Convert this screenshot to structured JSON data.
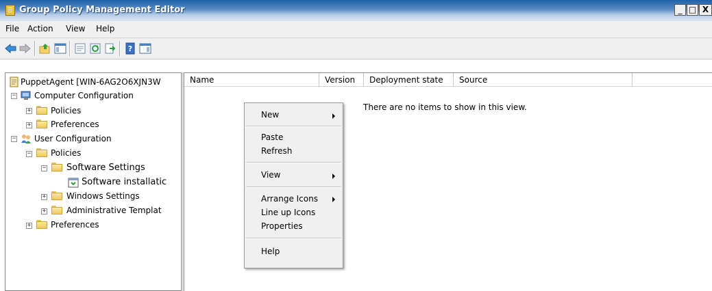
{
  "window": {
    "title": "Group Policy Management Editor",
    "controls": {
      "minimize": "_",
      "maximize": "□",
      "close": "X"
    }
  },
  "menu": [
    "File",
    "Action",
    "View",
    "Help"
  ],
  "toolbar": {
    "icons": [
      "back-arrow-icon",
      "forward-arrow-icon",
      "up-folder-icon",
      "show-hide-tree-icon",
      "properties-icon",
      "refresh-icon",
      "export-list-icon",
      "help-icon",
      "show-hide-action-pane-icon"
    ]
  },
  "tree": {
    "root": "PuppetAgent [WIN-6AG2O6XJN3W",
    "computer_config": "Computer Configuration",
    "cc_policies": "Policies",
    "cc_preferences": "Preferences",
    "user_config": "User Configuration",
    "uc_policies": "Policies",
    "software_settings": "Software Settings",
    "software_installation": "Software installatic",
    "windows_settings": "Windows Settings",
    "admin_templates": "Administrative Templat",
    "uc_preferences": "Preferences"
  },
  "list": {
    "columns": [
      "Name",
      "Version",
      "Deployment state",
      "Source"
    ],
    "empty_message": "There are no items to show in this view."
  },
  "context_menu": {
    "new": "New",
    "paste": "Paste",
    "refresh": "Refresh",
    "view": "View",
    "arrange_icons": "Arrange Icons",
    "line_up_icons": "Line up Icons",
    "properties": "Properties",
    "help": "Help"
  },
  "colors": {
    "title_bar": "#1f62a8",
    "chrome": "#f0f0f0",
    "folder": "#f2d16b"
  }
}
